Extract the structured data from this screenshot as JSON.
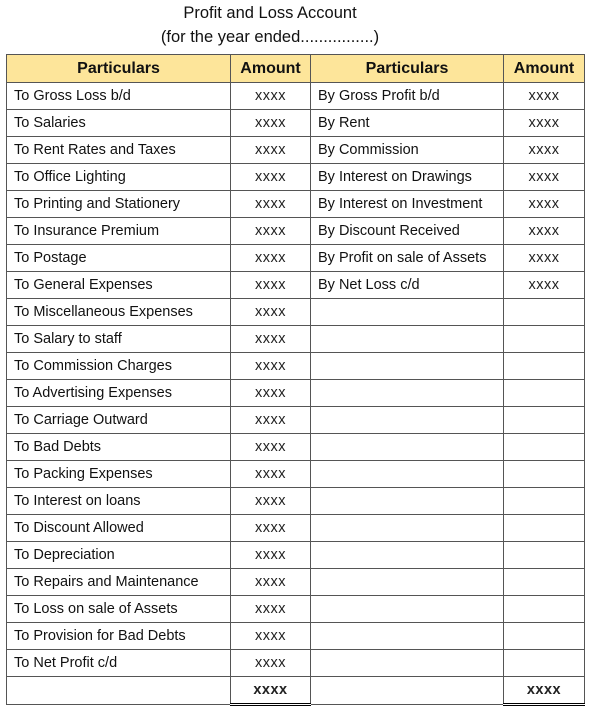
{
  "title": "Profit and Loss Account",
  "subtitle": "(for the year ended................)",
  "headers": {
    "debit_particulars": "Particulars",
    "debit_amount": "Amount",
    "credit_particulars": "Particulars",
    "credit_amount": "Amount"
  },
  "colors": {
    "header_bg": "#FDE59A",
    "border": "#555555"
  },
  "rows": [
    {
      "d": "To Gross Loss b/d",
      "da": "xxxx",
      "c": "By Gross Profit b/d",
      "ca": "xxxx"
    },
    {
      "d": "To Salaries",
      "da": "xxxx",
      "c": "By Rent",
      "ca": "xxxx"
    },
    {
      "d": "To Rent Rates and Taxes",
      "da": "xxxx",
      "c": "By Commission",
      "ca": "xxxx"
    },
    {
      "d": "To Office Lighting",
      "da": "xxxx",
      "c": "By Interest on Drawings",
      "ca": "xxxx"
    },
    {
      "d": "To Printing and Stationery",
      "da": "xxxx",
      "c": "By Interest on Investment",
      "ca": "xxxx"
    },
    {
      "d": "To Insurance Premium",
      "da": "xxxx",
      "c": "By Discount Received",
      "ca": "xxxx"
    },
    {
      "d": "To Postage",
      "da": "xxxx",
      "c": "By Profit on sale of Assets",
      "ca": "xxxx"
    },
    {
      "d": "To General Expenses",
      "da": "xxxx",
      "c": "By Net Loss c/d",
      "ca": "xxxx"
    },
    {
      "d": "To Miscellaneous Expenses",
      "da": "xxxx",
      "c": "",
      "ca": ""
    },
    {
      "d": "To Salary to staff",
      "da": "xxxx",
      "c": "",
      "ca": ""
    },
    {
      "d": "To Commission Charges",
      "da": "xxxx",
      "c": "",
      "ca": ""
    },
    {
      "d": "To Advertising Expenses",
      "da": "xxxx",
      "c": "",
      "ca": ""
    },
    {
      "d": "To Carriage Outward",
      "da": "xxxx",
      "c": "",
      "ca": ""
    },
    {
      "d": "To Bad Debts",
      "da": "xxxx",
      "c": "",
      "ca": ""
    },
    {
      "d": "To Packing Expenses",
      "da": "xxxx",
      "c": "",
      "ca": ""
    },
    {
      "d": "To Interest on loans",
      "da": "xxxx",
      "c": "",
      "ca": ""
    },
    {
      "d": "To Discount Allowed",
      "da": "xxxx",
      "c": "",
      "ca": ""
    },
    {
      "d": "To Depreciation",
      "da": "xxxx",
      "c": "",
      "ca": ""
    },
    {
      "d": "To Repairs and Maintenance",
      "da": "xxxx",
      "c": "",
      "ca": ""
    },
    {
      "d": "To Loss on sale of Assets",
      "da": "xxxx",
      "c": "",
      "ca": ""
    },
    {
      "d": "To Provision for Bad Debts",
      "da": "xxxx",
      "c": "",
      "ca": ""
    },
    {
      "d": "To Net Profit c/d",
      "da": "xxxx",
      "c": "",
      "ca": ""
    }
  ],
  "totals": {
    "debit": "xxxx",
    "credit": "xxxx"
  }
}
